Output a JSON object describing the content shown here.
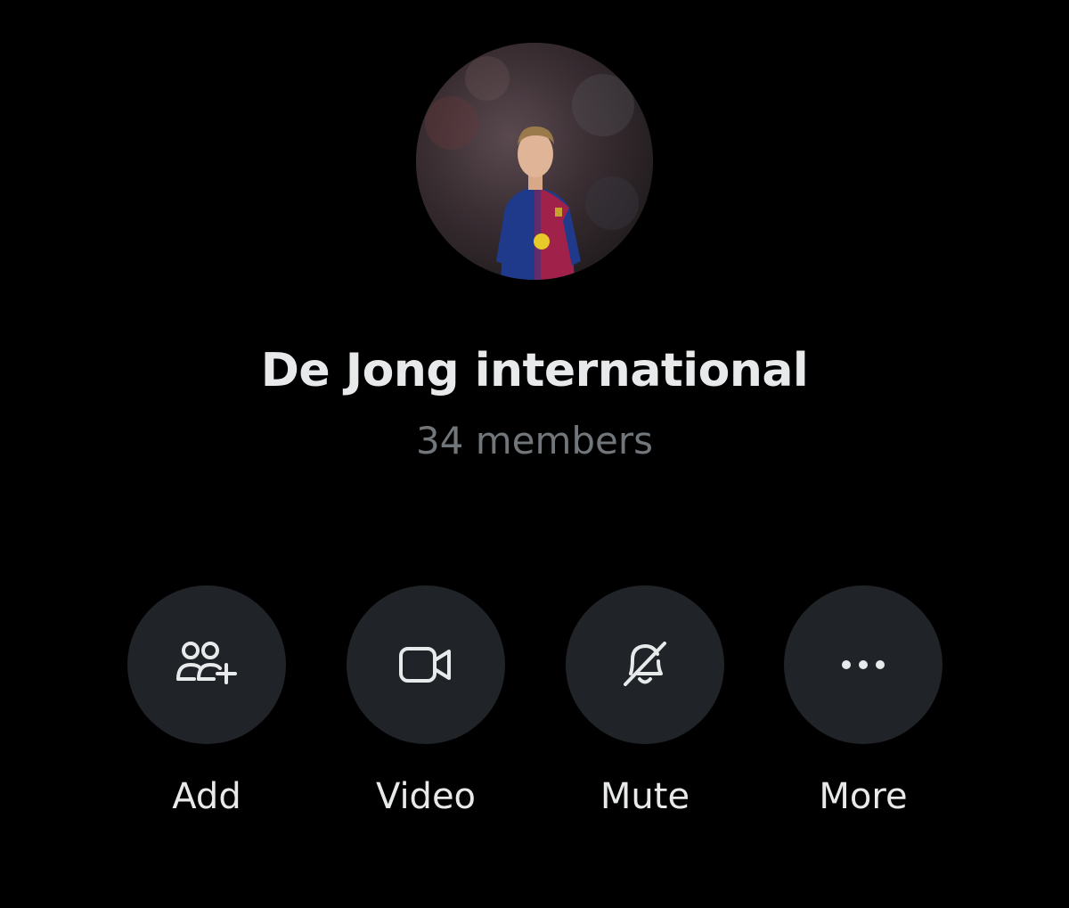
{
  "group": {
    "name": "De Jong international",
    "members": "34 members",
    "avatar_alt": "group-avatar"
  },
  "actions": [
    {
      "label": "Add",
      "icon": "add-people-icon"
    },
    {
      "label": "Video",
      "icon": "video-camera-icon"
    },
    {
      "label": "Mute",
      "icon": "bell-off-icon"
    },
    {
      "label": "More",
      "icon": "more-dots-icon"
    }
  ],
  "colors": {
    "background": "#000000",
    "text_primary": "#e7e9ea",
    "text_secondary": "#71767b",
    "button_bg": "#202327"
  }
}
